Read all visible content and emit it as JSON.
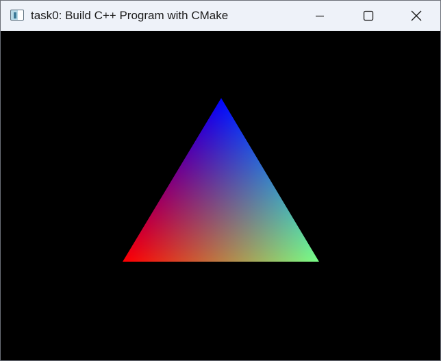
{
  "window": {
    "title": "task0: Build C++ Program with CMake",
    "icon": "app-window-icon"
  },
  "title_bar_controls": {
    "minimize": "minimize-icon",
    "maximize": "maximize-icon",
    "close": "close-icon"
  },
  "scene": {
    "background": "#000000",
    "shape": "triangle",
    "vertex_colors": {
      "top": "#0000ff",
      "bottom_left": "#ff0000",
      "bottom_right": "#00ff00"
    }
  }
}
